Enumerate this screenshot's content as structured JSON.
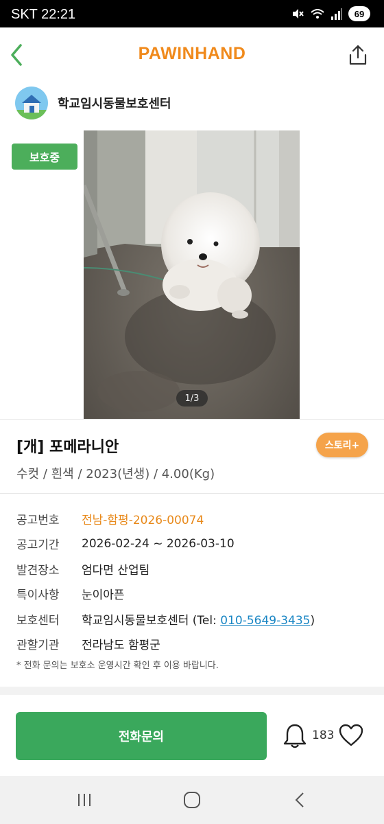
{
  "status_bar": {
    "carrier": "SKT",
    "time": "22:21",
    "battery": "69"
  },
  "header": {
    "title": "PAWINHAND"
  },
  "shelter": {
    "name": "학교임시동물보호센터"
  },
  "badge": {
    "status": "보호중"
  },
  "photo": {
    "counter": "1/3"
  },
  "animal": {
    "title": "[개] 포메라니안",
    "subtitle": "수컷 / 흰색 / 2023(년생) / 4.00(Kg)",
    "story_button": "스토리+"
  },
  "info": {
    "rows": [
      {
        "label": "공고번호",
        "value": "전남-함평-2026-00074"
      },
      {
        "label": "공고기간",
        "value": "2026-02-24 ~ 2026-03-10"
      },
      {
        "label": "발견장소",
        "value": "엄다면 산업팀"
      },
      {
        "label": "특이사항",
        "value": "눈이아픈"
      },
      {
        "label": "보호센터",
        "value": "학교임시동물보호센터 (Tel: ",
        "tel": "010-5649-3435",
        "suffix": ")"
      },
      {
        "label": "관할기관",
        "value": "전라남도 함평군"
      }
    ],
    "notice": "* 전화 문의는 보호소 운영시간 확인 후 이용 바랍니다."
  },
  "actions": {
    "call_label": "전화문의",
    "like_count": "183"
  },
  "colors": {
    "brand_orange": "#f08a1c",
    "green": "#3aa85c",
    "badge_green": "#4cae5b",
    "story_orange": "#f5a34a",
    "link_blue": "#1a86c4"
  }
}
